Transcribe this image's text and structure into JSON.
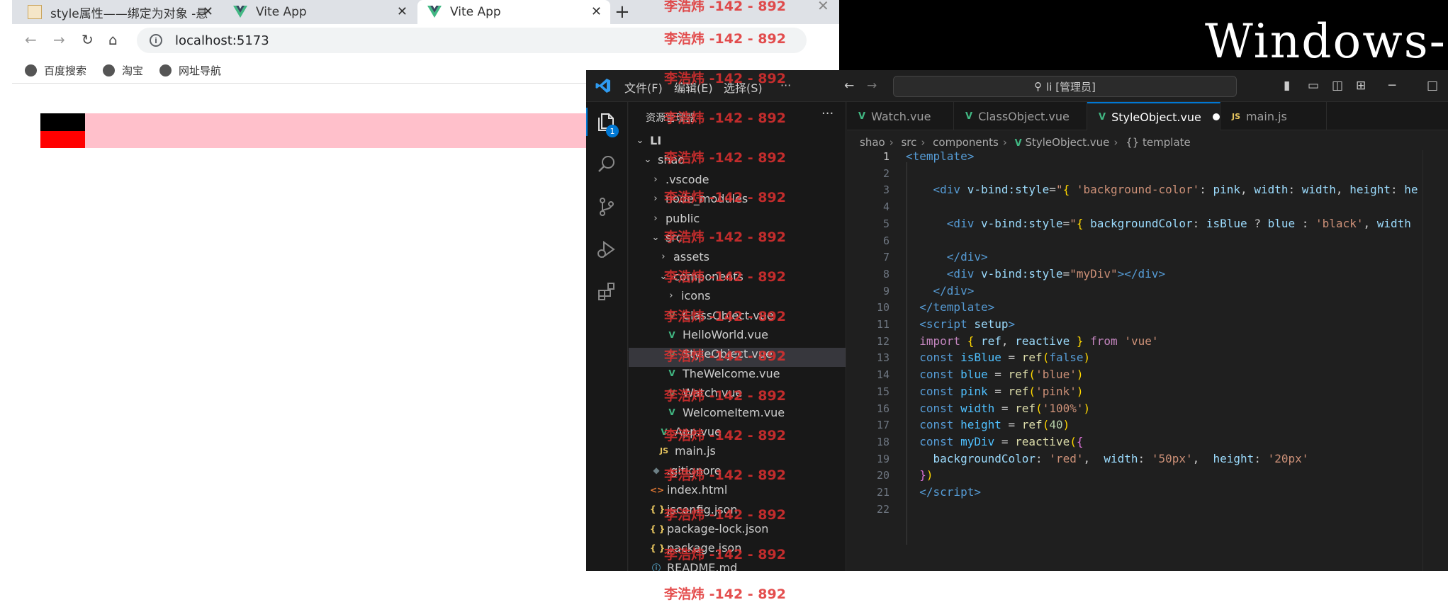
{
  "desktop": {
    "title_text": "Windows-"
  },
  "browser": {
    "tabs": [
      {
        "label": "style属性——绑定为对象 -悬",
        "active": false
      },
      {
        "label": "Vite App",
        "active": false
      },
      {
        "label": "Vite App",
        "active": true
      }
    ],
    "address": "localhost:5173",
    "bookmarks": [
      "百度搜索",
      "淘宝",
      "网址导航"
    ]
  },
  "vscode": {
    "menus": [
      "文件(F)",
      "编辑(E)",
      "选择(S)",
      "···"
    ],
    "search": "li [管理员]",
    "explorer_title": "资源管理器",
    "explorer_badge": "1",
    "tree": [
      {
        "label": "LI",
        "depth": 0,
        "type": "folder-open"
      },
      {
        "label": "shao",
        "depth": 1,
        "type": "folder-open"
      },
      {
        "label": ".vscode",
        "depth": 2,
        "type": "folder"
      },
      {
        "label": "node_modules",
        "depth": 2,
        "type": "folder"
      },
      {
        "label": "public",
        "depth": 2,
        "type": "folder"
      },
      {
        "label": "src",
        "depth": 2,
        "type": "folder-open"
      },
      {
        "label": "assets",
        "depth": 3,
        "type": "folder"
      },
      {
        "label": "components",
        "depth": 3,
        "type": "folder-open"
      },
      {
        "label": "icons",
        "depth": 4,
        "type": "folder"
      },
      {
        "label": "ClassObject.vue",
        "depth": 4,
        "type": "vue"
      },
      {
        "label": "HelloWorld.vue",
        "depth": 4,
        "type": "vue"
      },
      {
        "label": "StyleObject.vue",
        "depth": 4,
        "type": "vue"
      },
      {
        "label": "TheWelcome.vue",
        "depth": 4,
        "type": "vue"
      },
      {
        "label": "Watch.vue",
        "depth": 4,
        "type": "vue"
      },
      {
        "label": "WelcomeItem.vue",
        "depth": 4,
        "type": "vue"
      },
      {
        "label": "App.vue",
        "depth": 3,
        "type": "vue"
      },
      {
        "label": "main.js",
        "depth": 3,
        "type": "js"
      },
      {
        "label": ".gitignore",
        "depth": 2,
        "type": "git"
      },
      {
        "label": "index.html",
        "depth": 2,
        "type": "html"
      },
      {
        "label": "jsconfig.json",
        "depth": 2,
        "type": "json"
      },
      {
        "label": "package-lock.json",
        "depth": 2,
        "type": "json"
      },
      {
        "label": "package.json",
        "depth": 2,
        "type": "json"
      },
      {
        "label": "README.md",
        "depth": 2,
        "type": "info"
      }
    ],
    "editor_tabs": [
      {
        "label": "Watch.vue",
        "icon": "V",
        "active": false
      },
      {
        "label": "ClassObject.vue",
        "icon": "V",
        "active": false
      },
      {
        "label": "StyleObject.vue",
        "icon": "V",
        "active": true,
        "modified": true
      },
      {
        "label": "main.js",
        "icon": "JS",
        "active": false
      }
    ],
    "breadcrumb": [
      "shao",
      "src",
      "components",
      "StyleObject.vue",
      "{} template"
    ],
    "line_numbers": [
      "1",
      "2",
      "3",
      "4",
      "5",
      "6",
      "7",
      "8",
      "9",
      "10",
      "11",
      "12",
      "13",
      "14",
      "15",
      "16",
      "17",
      "18",
      "19",
      "20",
      "21",
      "22"
    ]
  },
  "watermark": "李浩炜 -142 - 892"
}
